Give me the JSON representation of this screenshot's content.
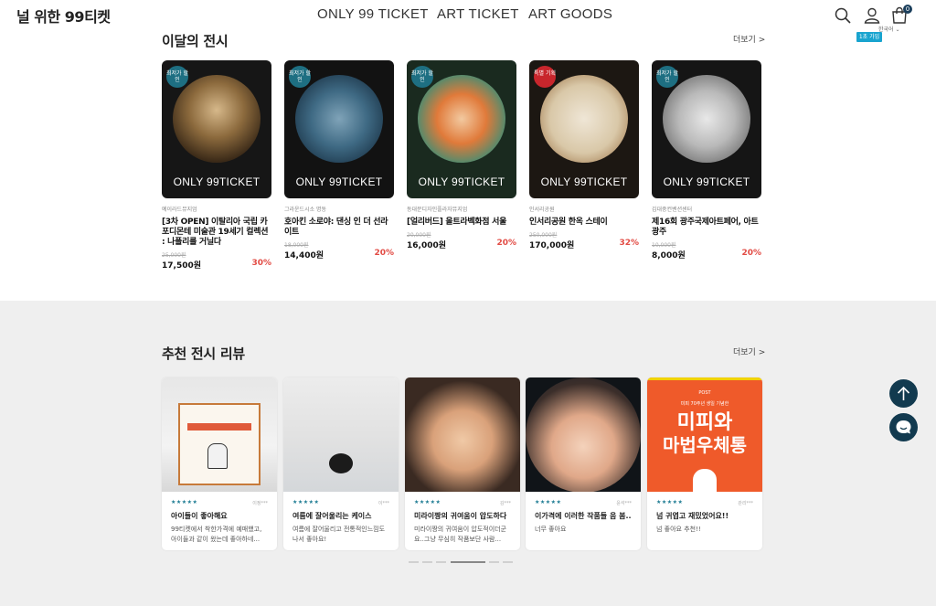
{
  "header": {
    "logo": "널 위한 99티켓",
    "nav": [
      "ONLY 99 TICKET",
      "ART TICKET",
      "ART GOODS"
    ],
    "cart_count": "0",
    "signup_badge": "1초 가입",
    "language": "한국어 ⌄"
  },
  "monthly": {
    "title": "이달의 전시",
    "more": "더보기 >",
    "card_logo": "ONLY 99TICKET",
    "items": [
      {
        "badge": "최저가 할인",
        "venue": "예이라드뮤지엄",
        "title": "[3차 OPEN] 이탈리아 국립 카포디몬테 미술관 19세기 컬렉션 : 나폴리를 거닐다",
        "original": "25,000원",
        "price": "17,500원",
        "rate": "30%"
      },
      {
        "badge": "최저가 할인",
        "venue": "그라운드시소 명동",
        "title": "호아킨 소로야: 댄싱 인 더 선라이트",
        "original": "18,000원",
        "price": "14,400원",
        "rate": "20%"
      },
      {
        "badge": "최저가 할인",
        "venue": "동대문디자인플라자뮤지엄",
        "title": "[얼리버드] 올트라벡화점 서울",
        "original": "20,000원",
        "price": "16,000원",
        "rate": "20%"
      },
      {
        "badge": "특별 기획",
        "venue": "인서리공원",
        "title": "인서리공원 한옥 스테이",
        "original": "250,000원",
        "price": "170,000원",
        "rate": "32%"
      },
      {
        "badge": "최저가 할인",
        "venue": "김대중컨벤션센터",
        "title": "제16회 광주국제아트페어, 아트광주",
        "original": "10,000원",
        "price": "8,000원",
        "rate": "20%"
      }
    ]
  },
  "reviews": {
    "title": "추천 전시 리뷰",
    "more": "더보기 >",
    "stars": "★★★★★",
    "items": [
      {
        "reviewer": "이정***",
        "title": "아이들이 좋아해요",
        "text": "99티켓에서 착한가격에 예매했고, 아이들과 같이 왔는데 좋아하네..."
      },
      {
        "reviewer": "이***",
        "title": "여름에 잘어울리는 케이스",
        "text": "여름에 잘어울리고 전통적인느낌도 나서 좋아요!"
      },
      {
        "reviewer": "김***",
        "title": "미라이짱의 귀여움이 압도하다",
        "text": "미라이짱의 귀여움이 압도적이더군요..그냥 무심히 작품보단 사람..."
      },
      {
        "reviewer": "윤석***",
        "title": "이가격에 이러한 작품들 음 봄...",
        "text": "너무 좋아요"
      },
      {
        "reviewer": "관리***",
        "title": "넘 귀엽고 재밌었어요!!",
        "text": "넘 좋아요 추천!!"
      }
    ]
  },
  "poster": {
    "tag": "POST",
    "subtitle": "미피 70주년 생일 기념한",
    "title_line1": "미피와",
    "title_line2": "마법우체통"
  },
  "colors": {
    "accent": "#123a4f",
    "discount": "#e24b44",
    "badge_teal": "#1e6f82",
    "badge_red": "#c8262c",
    "signup": "#19a4cf"
  }
}
